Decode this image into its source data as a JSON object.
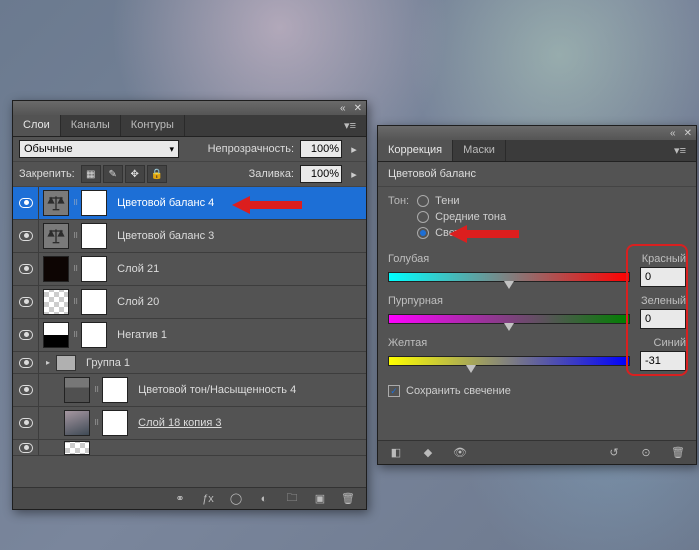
{
  "layers_panel": {
    "tabs": {
      "layers": "Слои",
      "channels": "Каналы",
      "paths": "Контуры"
    },
    "blend_mode": "Обычные",
    "opacity_label": "Непрозрачность:",
    "opacity_value": "100%",
    "lock_label": "Закрепить:",
    "fill_label": "Заливка:",
    "fill_value": "100%",
    "items": [
      {
        "name": "Цветовой баланс 4",
        "selected": true,
        "kind": "balance"
      },
      {
        "name": "Цветовой баланс 3",
        "selected": false,
        "kind": "balance"
      },
      {
        "name": "Слой 21",
        "selected": false,
        "kind": "black"
      },
      {
        "name": "Слой 20",
        "selected": false,
        "kind": "checker"
      },
      {
        "name": "Негатив 1",
        "selected": false,
        "kind": "neg"
      },
      {
        "name": "Группа 1",
        "selected": false,
        "kind": "group"
      },
      {
        "name": "Цветовой тон/Насыщенность 4",
        "selected": false,
        "kind": "hue",
        "indent": true
      },
      {
        "name": "Слой 18 копия 3",
        "selected": false,
        "kind": "photo",
        "indent": true,
        "underline": true
      }
    ]
  },
  "correction_panel": {
    "tabs": {
      "correction": "Коррекция",
      "masks": "Маски"
    },
    "title": "Цветовой баланс",
    "tone_label": "Тон:",
    "tones": {
      "shadows": "Тени",
      "midtones": "Средние тона",
      "highlights": "Света"
    },
    "tone_selected": "highlights",
    "sliders": [
      {
        "left": "Голубая",
        "right": "Красный",
        "value": "0",
        "pos": 50,
        "grad": "cr"
      },
      {
        "left": "Пурпурная",
        "right": "Зеленый",
        "value": "0",
        "pos": 50,
        "grad": "mg"
      },
      {
        "left": "Желтая",
        "right": "Синий",
        "value": "-31",
        "pos": 34,
        "grad": "yb"
      }
    ],
    "preserve_label": "Сохранить свечение",
    "preserve_checked": true
  }
}
